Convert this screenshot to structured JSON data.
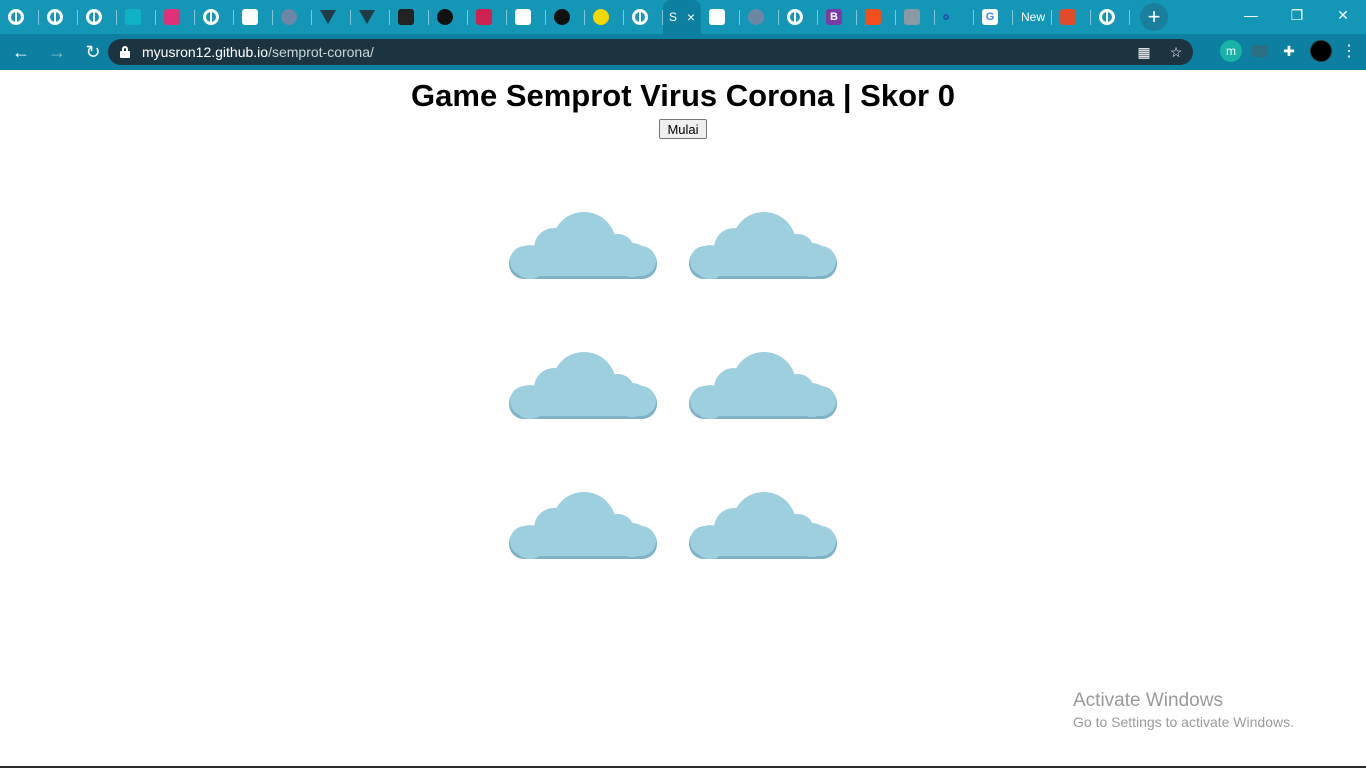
{
  "browser": {
    "tabs": [
      {
        "icon": "globe-icon"
      },
      {
        "icon": "globe-icon"
      },
      {
        "icon": "globe-icon"
      },
      {
        "icon": "square-app-icon",
        "color": "#10b3c6"
      },
      {
        "icon": "c-app-icon",
        "color": "#e0307a"
      },
      {
        "icon": "globe-icon"
      },
      {
        "icon": "blue-app-icon",
        "color": "#ffffff"
      },
      {
        "icon": "sphere-icon",
        "color": "#6e86a6"
      },
      {
        "icon": "triangle-icon",
        "color": "#223a48"
      },
      {
        "icon": "triangle-icon",
        "color": "#223a48"
      },
      {
        "icon": "dark-app-icon",
        "color": "#222222"
      },
      {
        "icon": "github-icon",
        "color": "#111111"
      },
      {
        "icon": "striped-app-icon",
        "color": "#d02050"
      },
      {
        "icon": "codepen-icon",
        "color": "#ffffff"
      },
      {
        "icon": "github-icon",
        "color": "#111111"
      },
      {
        "icon": "pacman-icon",
        "color": "#f5d800"
      },
      {
        "icon": "globe-icon"
      }
    ],
    "active_tab": {
      "title": "S",
      "close": "×"
    },
    "tabs_after": [
      {
        "icon": "blue-app-icon",
        "color": "#ffffff"
      },
      {
        "icon": "sphere-icon",
        "color": "#6e86a6"
      },
      {
        "icon": "globe-icon"
      },
      {
        "icon": "bootstrap-icon",
        "color": "#7a3ba8",
        "letter": "B"
      },
      {
        "icon": "figma-icon",
        "color": "#f24e1e"
      },
      {
        "icon": "layers-icon",
        "color": "#8a9aa4"
      },
      {
        "icon": "dot-icon",
        "color": "#1f5aa6"
      },
      {
        "icon": "google-icon",
        "color": "#ffffff",
        "letter": "G"
      }
    ],
    "new_tab_text": "New",
    "tabs_end": [
      {
        "icon": "red-app-icon",
        "color": "#e04a2a"
      },
      {
        "icon": "globe-icon"
      }
    ],
    "new_tab_button": "+",
    "window_controls": {
      "minimize": "—",
      "restore": "❐",
      "close": "✕"
    },
    "url": {
      "host": "myusron12.github.io",
      "path": "/semprot-corona/"
    },
    "nav": {
      "back": "←",
      "forward": "→",
      "reload": "↻"
    },
    "omni_icons": {
      "qr": "▦",
      "star": "☆"
    },
    "extensions": {
      "m_letter": "m",
      "puzzle": "✚",
      "menu": "⋮"
    }
  },
  "page": {
    "title": "Game Semprot Virus Corona | Skor",
    "score": "0",
    "start_button": "Mulai",
    "cloud_count_label": "6",
    "cloud_color": "#9ecfde",
    "cloud_shadow_color": "#7fb2c4"
  },
  "watermark": {
    "line1": "Activate Windows",
    "line2": "Go to Settings to activate Windows."
  }
}
